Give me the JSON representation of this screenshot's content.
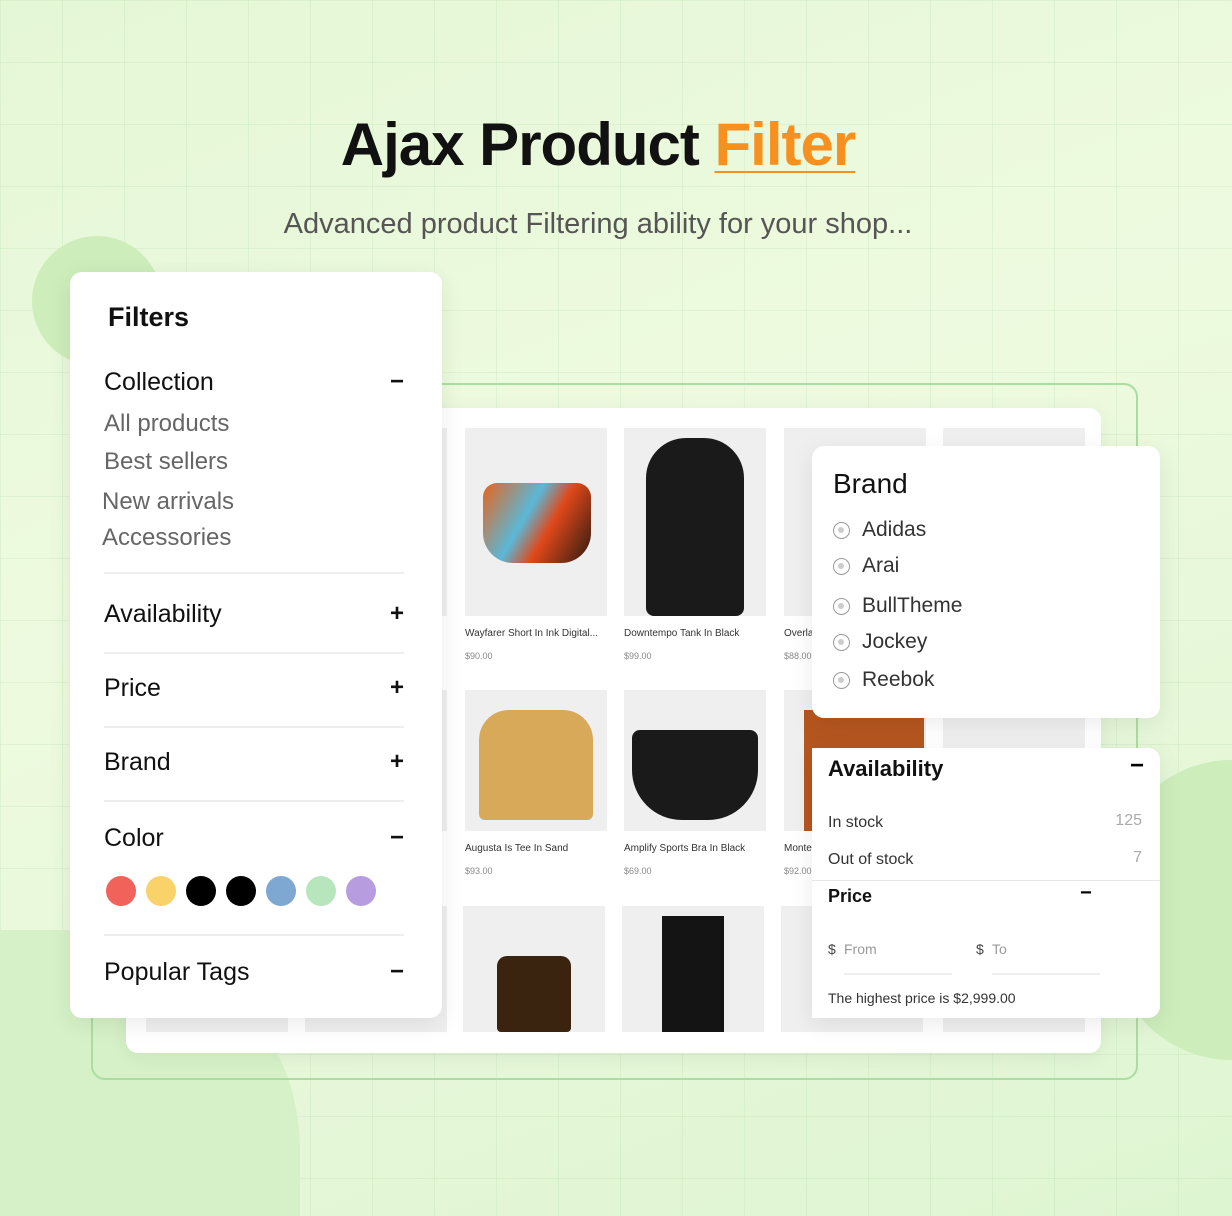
{
  "header": {
    "title_main": "Ajax Product ",
    "title_accent": "Filter",
    "subtitle": "Advanced product Filtering ability for your shop..."
  },
  "colors": {
    "accent": "#f7901e",
    "background": "#e4f7d6",
    "frame": "#a9dea0"
  },
  "products": [
    {
      "name": "Wayfarer Short In Ink Digital...",
      "price": "$90.00"
    },
    {
      "name": "Downtempo Tank In Black",
      "price": "$99.00"
    },
    {
      "name": "Overla",
      "price": "$88.00"
    },
    {
      "name": "Augusta Is Tee In Sand",
      "price": "$93.00"
    },
    {
      "name": "Amplify Sports Bra In Black",
      "price": "$69.00"
    },
    {
      "name": "Monte",
      "price": "$92.00"
    }
  ],
  "filters": {
    "title": "Filters",
    "collection": {
      "label": "Collection",
      "toggle": "−",
      "items": [
        "All products",
        "Best sellers",
        "New arrivals",
        "Accessories"
      ]
    },
    "availability": {
      "label": "Availability",
      "toggle": "+"
    },
    "price": {
      "label": "Price",
      "toggle": "+"
    },
    "brand": {
      "label": "Brand",
      "toggle": "+"
    },
    "color": {
      "label": "Color",
      "toggle": "−",
      "swatches": [
        "#f0625a",
        "#f9d26a",
        "#000000",
        "#000000",
        "#7ea8d2",
        "#b8e6bc",
        "#b79ce0"
      ]
    },
    "popular_tags": {
      "label": "Popular Tags",
      "toggle": "−"
    }
  },
  "brand_panel": {
    "title": "Brand",
    "options": [
      "Adidas",
      "Arai",
      "BullTheme",
      "Jockey",
      "Reebok"
    ]
  },
  "availability_panel": {
    "title": "Availability",
    "toggle": "−",
    "options": [
      {
        "label": "In stock",
        "count": "125"
      },
      {
        "label": "Out of stock",
        "count": "7"
      }
    ]
  },
  "price_panel": {
    "title": "Price",
    "toggle": "−",
    "currency": "$",
    "from_placeholder": "From",
    "to_placeholder": "To",
    "note": "The highest price is $2,999.00"
  }
}
